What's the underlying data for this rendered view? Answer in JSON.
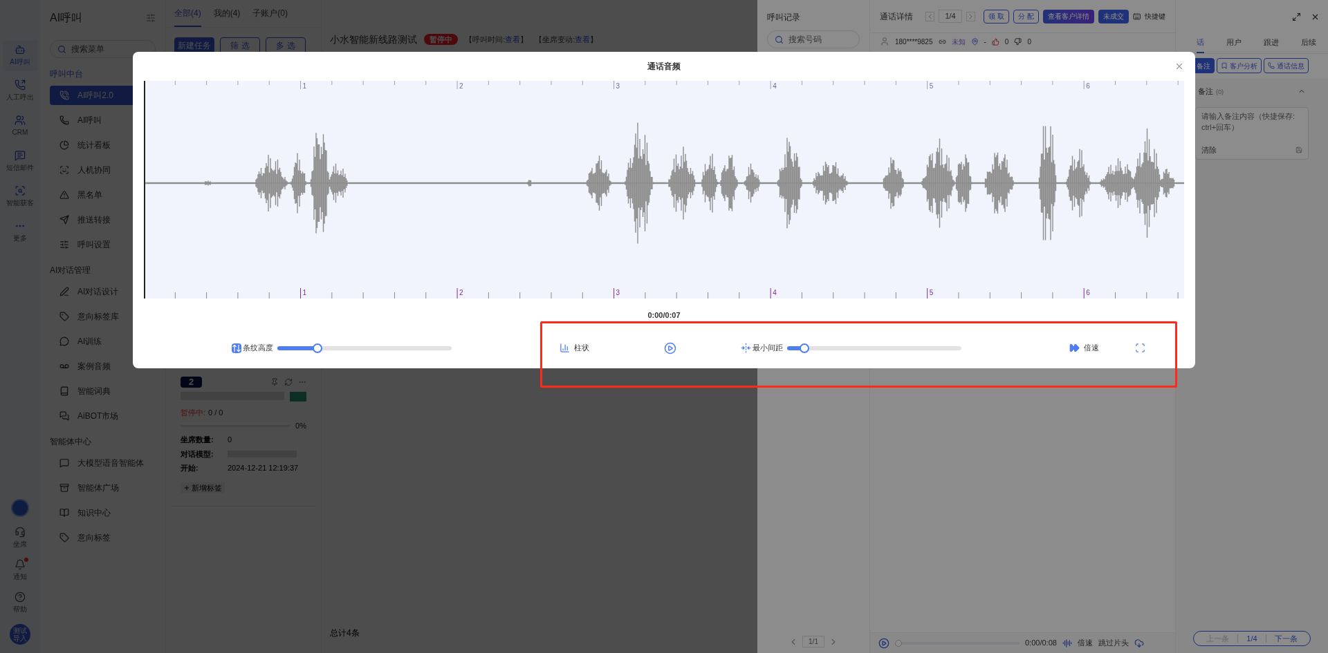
{
  "rail": {
    "items": [
      {
        "label": "AI呼叫",
        "selected": true
      },
      {
        "label": "人工呼出",
        "selected": false
      },
      {
        "label": "CRM",
        "selected": false
      },
      {
        "label": "短信邮件",
        "selected": false
      },
      {
        "label": "智能获客",
        "selected": false
      },
      {
        "label": "更多",
        "selected": false
      }
    ],
    "bottom_items": [
      {
        "label": "坐席",
        "badge": false
      },
      {
        "label": "通知",
        "badge": true
      },
      {
        "label": "帮助",
        "badge": false
      }
    ],
    "avatar": "测试导入"
  },
  "menu": {
    "title": "AI呼叫",
    "search_placeholder": "搜索菜单",
    "groups": [
      {
        "title": "呼叫中台",
        "items": [
          {
            "label": "AI呼叫2.0",
            "selected": true
          },
          {
            "label": "AI呼叫",
            "selected": false
          },
          {
            "label": "统计看板",
            "selected": false
          },
          {
            "label": "人机协同",
            "selected": false
          },
          {
            "label": "黑名单",
            "selected": false
          },
          {
            "label": "推送转接",
            "selected": false
          },
          {
            "label": "呼叫设置",
            "selected": false
          }
        ]
      },
      {
        "title": "AI对话管理",
        "items": [
          {
            "label": "AI对话设计",
            "selected": false
          },
          {
            "label": "意向标签库",
            "selected": false
          },
          {
            "label": "AI训练",
            "selected": false
          },
          {
            "label": "案例音频",
            "selected": false
          },
          {
            "label": "智能词典",
            "selected": false
          },
          {
            "label": "AiBOT市场",
            "selected": false
          }
        ]
      },
      {
        "title": "智能体中心",
        "items": [
          {
            "label": "大模型语音智能体",
            "selected": false
          },
          {
            "label": "智能体广场",
            "selected": false
          },
          {
            "label": "知识中心",
            "selected": false
          },
          {
            "label": "意向标签",
            "selected": false
          }
        ]
      }
    ]
  },
  "tasks": {
    "tabs": [
      {
        "label": "全部(4)",
        "selected": true
      },
      {
        "label": "我的(4)",
        "selected": false
      },
      {
        "label": "子账户(0)",
        "selected": false
      }
    ],
    "buttons": [
      {
        "label": "新建任务",
        "kind": "primary"
      },
      {
        "label": "筛 选",
        "kind": "outline"
      },
      {
        "label": "多 选",
        "kind": "outline"
      }
    ],
    "card": {
      "index": "2",
      "status": "暂停中:",
      "count": "0 / 0",
      "level": 0,
      "percent": "0%",
      "fields": [
        {
          "label": "坐席数量:",
          "value": "0"
        },
        {
          "label": "对话模型:"
        },
        {
          "label": "开始:",
          "value": "2024-12-21 12:19:37"
        }
      ],
      "add_tag": "新增标签"
    }
  },
  "main": {
    "title": "小水智能新线路测试",
    "status": "暂停中",
    "meta": [
      {
        "label": "【呼叫时间:",
        "link": "查看",
        "suffix": "】"
      },
      {
        "label": "【坐席变动:",
        "link": "查看",
        "suffix": "】"
      }
    ],
    "total": "总计4条"
  },
  "drawer": {
    "records": {
      "title": "呼叫记录",
      "search_placeholder": "搜索号码",
      "page": "1/1"
    },
    "details": {
      "title": "通话详情",
      "page": "1/4",
      "buttons": [
        {
          "label": "领 取",
          "kind": "outline"
        },
        {
          "label": "分 配",
          "kind": "outline"
        },
        {
          "label": "查看客户详情",
          "kind": "gradient"
        },
        {
          "label": "未成交",
          "kind": "primary"
        }
      ],
      "shortcut": "快捷键",
      "phone": "180****9825",
      "intent": "未知",
      "location": "-",
      "likes": "0",
      "dislikes": "0",
      "player": {
        "time": "0:00/0:08",
        "level": 0,
        "speed": "倍速",
        "skip": "跳过片头"
      }
    },
    "side": {
      "tabs": [
        {
          "label": "话",
          "selected": true
        },
        {
          "label": "用户",
          "selected": false
        },
        {
          "label": "跟进",
          "selected": false
        },
        {
          "label": "后续",
          "selected": false
        }
      ],
      "actions": [
        {
          "label": "备注",
          "selected": true
        },
        {
          "label": "客户分析",
          "selected": false
        },
        {
          "label": "通话信息",
          "selected": false
        }
      ],
      "note": {
        "title": "备注",
        "count": "(0)",
        "expanded": true,
        "placeholder": "请输入备注内容（快捷保存: ctrl+回车）",
        "clear": "清除"
      },
      "pager": {
        "prev": "上一条",
        "prev_disabled": true,
        "page": "1/4",
        "next": "下一条"
      }
    }
  },
  "modal": {
    "title": "通话音频",
    "top_ruler": [
      "1",
      "2",
      "3",
      "4",
      "5",
      "6"
    ],
    "bottom_ruler": [
      "1",
      "2",
      "3",
      "4",
      "5",
      "6"
    ],
    "time": "0:00/0:07",
    "controls": {
      "height_slider": {
        "label": "条纹高度",
        "level": 0.23
      },
      "bars_label": "柱状",
      "gap_slider": {
        "label": "最小间距",
        "level": 0.1
      },
      "speed_label": "倍速"
    }
  }
}
